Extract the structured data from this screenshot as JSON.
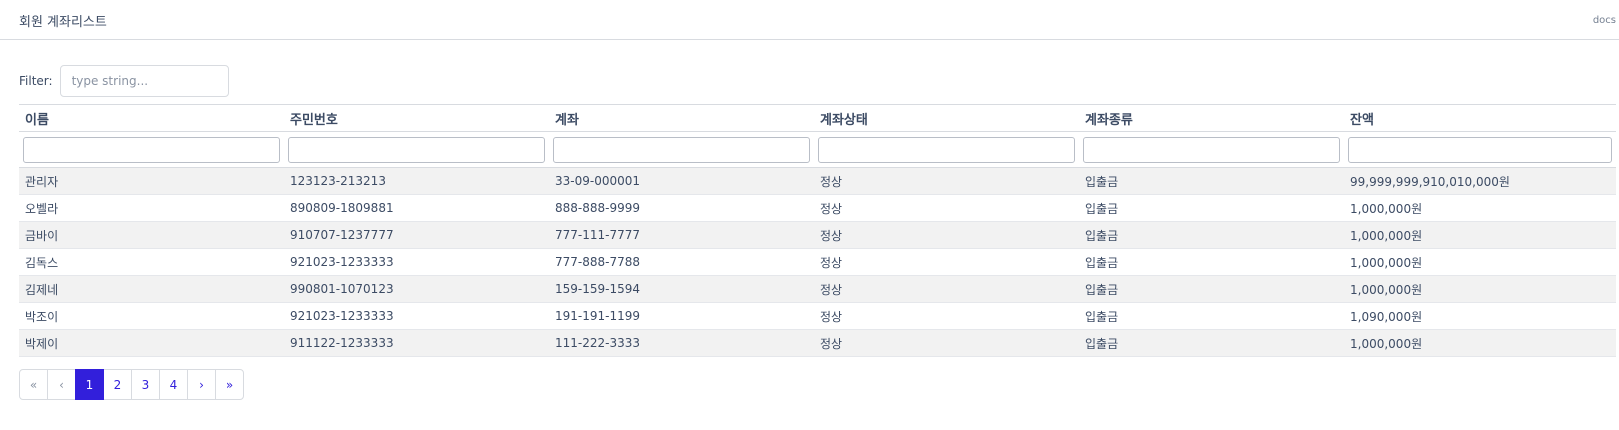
{
  "header": {
    "title": "회원 계좌리스트",
    "docs_label": "docs"
  },
  "filter": {
    "label": "Filter:",
    "placeholder": "type string..."
  },
  "table": {
    "columns": [
      "이름",
      "주민번호",
      "계좌",
      "계좌상태",
      "계좌종류",
      "잔액"
    ],
    "rows": [
      [
        "관리자",
        "123123-213213",
        "33-09-000001",
        "정상",
        "입출금",
        "99,999,999,910,010,000원"
      ],
      [
        "오벨라",
        "890809-1809881",
        "888-888-9999",
        "정상",
        "입출금",
        "1,000,000원"
      ],
      [
        "금바이",
        "910707-1237777",
        "777-111-7777",
        "정상",
        "입출금",
        "1,000,000원"
      ],
      [
        "김독스",
        "921023-1233333",
        "777-888-7788",
        "정상",
        "입출금",
        "1,000,000원"
      ],
      [
        "김제네",
        "990801-1070123",
        "159-159-1594",
        "정상",
        "입출금",
        "1,000,000원"
      ],
      [
        "박조이",
        "921023-1233333",
        "191-191-1199",
        "정상",
        "입출금",
        "1,090,000원"
      ],
      [
        "박제이",
        "911122-1233333",
        "111-222-3333",
        "정상",
        "입출금",
        "1,000,000원"
      ]
    ]
  },
  "pagination": {
    "first": "«",
    "prev": "‹",
    "pages": [
      "1",
      "2",
      "3",
      "4"
    ],
    "active_page": "1",
    "next": "›",
    "last": "»"
  },
  "colors": {
    "accent": "#321fdb",
    "text": "#3c4b64",
    "striped_row": "#f2f2f2",
    "border": "#d8dbe0"
  }
}
